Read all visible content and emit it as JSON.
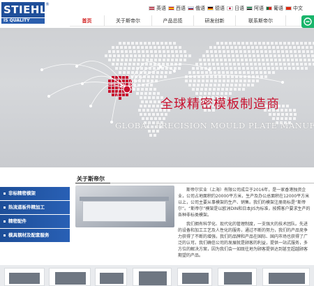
{
  "logo": {
    "brand": "STIEHL",
    "reg": "®",
    "tagline": "IS QUALITY"
  },
  "languages": [
    {
      "label": "英语",
      "color": "#3c3b6e"
    },
    {
      "label": "西语",
      "color": "#c60b1e"
    },
    {
      "label": "俄语",
      "color": "#0039a6"
    },
    {
      "label": "德语",
      "color": "#000000"
    },
    {
      "label": "日语",
      "color": "#bc002d"
    },
    {
      "label": "阿语",
      "color": "#007a3d"
    },
    {
      "label": "葡语",
      "color": "#046a38"
    },
    {
      "label": "中文",
      "color": "#de2910"
    }
  ],
  "nav": {
    "items": [
      {
        "label": "首页",
        "active": true
      },
      {
        "label": "关于斯帝尔",
        "active": false
      },
      {
        "label": "产品总揽",
        "active": false
      },
      {
        "label": "研发创新",
        "active": false
      },
      {
        "label": "联系斯帝尔",
        "active": false
      }
    ]
  },
  "banner": {
    "tagline": "全球精密模板制造商",
    "tagline_en": "GLOBAL PRECISION MOULD PLATE MANUFACTURER"
  },
  "sidebar": {
    "items": [
      {
        "label": "非标精密模架"
      },
      {
        "label": "热流道板件精加工"
      },
      {
        "label": "精密配件"
      },
      {
        "label": "模具钢材及配套服务"
      }
    ]
  },
  "about": {
    "title": "关于斯帝尔",
    "paragraphs": [
      "斯帝尔实业（上海）有限公司成立于2016年，是一家香港独资企业，公司占地面积约20000平方米，生产及办公总面积在12000平方米以上，公司主要从事模架的生产、销售。我们的模架注册商标是“斯帝尔”。“斯帝尔”模架是以欧洲DIN和日本JIS为标准，按照客户要求生产的各种非标类模架。",
      "我们拥有科学化、现代化的管理制度，一支强大的技术团队。先进的设备和加工工艺及人性化的服务，通过不断的努力，我们的产品竞争力获得了不断的增强，我们的品牌和产品在国际、国内市场也获得了广泛的认可。我们确信公司的发展就是顾客的利益，提供一站式服务，多方位的解决方案，因为我们会一如既往地为顾客提供达到甚至超越顾客期望的产品。"
    ]
  },
  "colors": {
    "brand_blue": "#1f4f9a",
    "accent_red": "#c8102e",
    "chat_green": "#19b56b"
  }
}
